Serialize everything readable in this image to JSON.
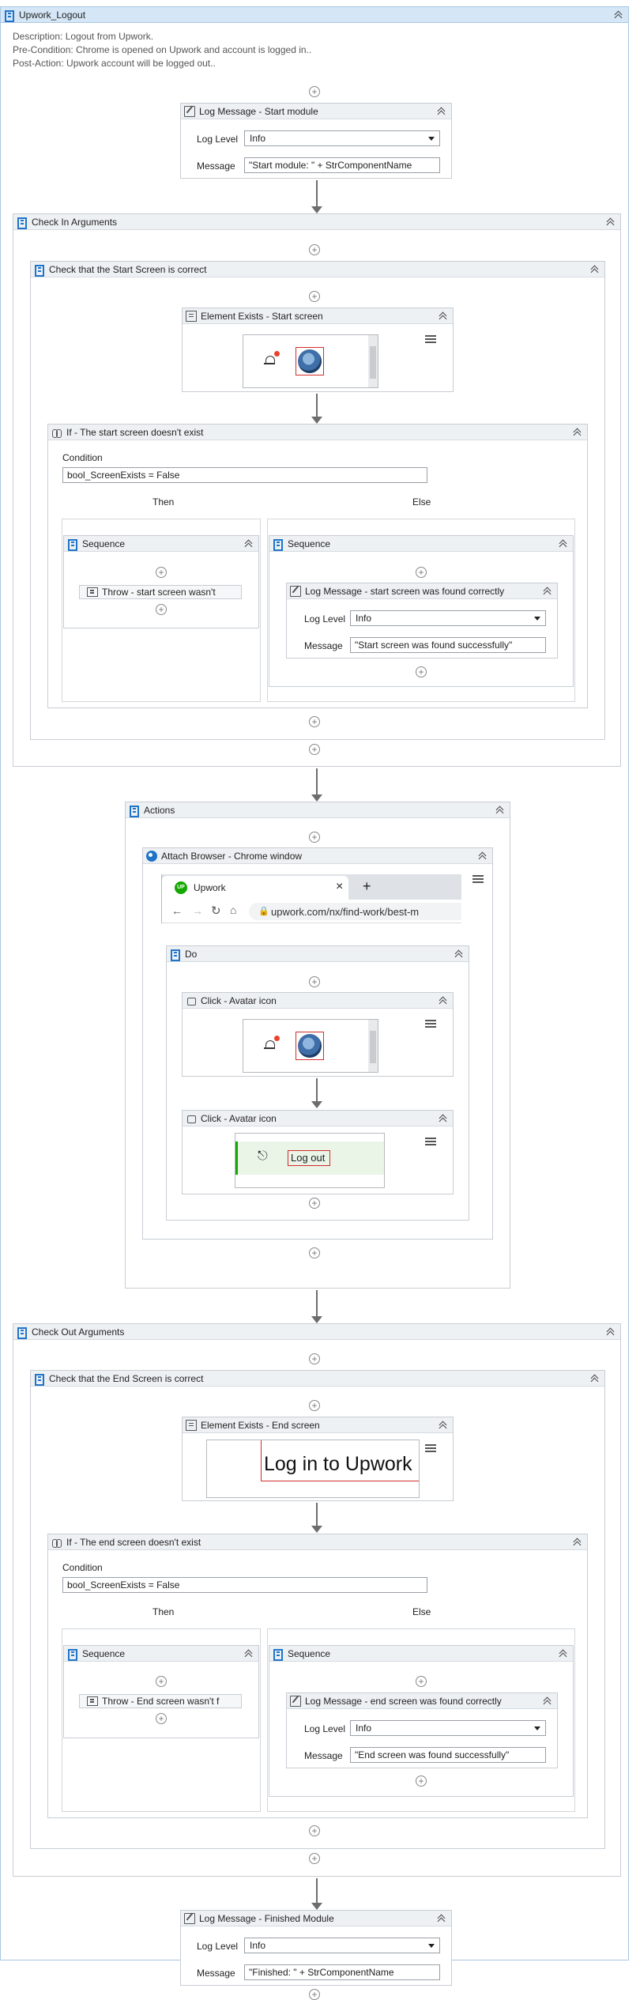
{
  "workflow": {
    "title": "Upwork_Logout",
    "description": "Description: Logout from Upwork.",
    "precondition": "Pre-Condition: Chrome is opened on Upwork and account is logged in..",
    "postaction": "Post-Action: Upwork account will be logged out.."
  },
  "log_start": {
    "title": "Log Message - Start module",
    "log_level_label": "Log Level",
    "log_level": "Info",
    "message_label": "Message",
    "message": "\"Start module: \" + StrComponentName"
  },
  "check_in": {
    "title": "Check In Arguments",
    "start_screen_check": {
      "title": "Check that the Start Screen is correct",
      "element_exists_title": "Element Exists - Start screen",
      "if": {
        "title": "If - The start screen doesn't exist",
        "condition_label": "Condition",
        "condition": "bool_ScreenExists = False",
        "then_label": "Then",
        "else_label": "Else",
        "then_sequence": "Sequence",
        "throw": "Throw - start screen wasn't",
        "else_sequence": "Sequence",
        "log": {
          "title": "Log Message - start screen was found correctly",
          "log_level_label": "Log Level",
          "log_level": "Info",
          "message_label": "Message",
          "message": "\"Start screen was found successfully\""
        }
      }
    }
  },
  "actions": {
    "title": "Actions",
    "attach_title": "Attach Browser - Chrome window",
    "browser": {
      "tab_title": "Upwork",
      "tab_logo": "UP",
      "close_glyph": "×",
      "newtab_glyph": "+",
      "url": "upwork.com/nx/find-work/best-m"
    },
    "do_title": "Do",
    "click1_title": "Click - Avatar icon",
    "click2_title": "Click - Avatar icon",
    "logout_label": "Log out"
  },
  "check_out": {
    "title": "Check Out Arguments",
    "end_screen_check": {
      "title": "Check that the End Screen is correct",
      "element_exists_title": "Element Exists - End screen",
      "preview_text": "Log in to Upwork",
      "if": {
        "title": "If - The end screen doesn't exist",
        "condition_label": "Condition",
        "condition": "bool_ScreenExists = False",
        "then_label": "Then",
        "else_label": "Else",
        "then_sequence": "Sequence",
        "throw": "Throw - End screen wasn't f",
        "else_sequence": "Sequence",
        "log": {
          "title": "Log Message - end screen was found correctly",
          "log_level_label": "Log Level",
          "log_level": "Info",
          "message_label": "Message",
          "message": "\"End screen was found successfully\""
        }
      }
    }
  },
  "log_finish": {
    "title": "Log Message - Finished Module",
    "log_level_label": "Log Level",
    "log_level": "Info",
    "message_label": "Message",
    "message": "\"Finished: \" + StrComponentName"
  },
  "colors": {
    "accent": "#1f74c9",
    "header_bg": "#eef1f4",
    "title_bar": "#d5e7f7",
    "selector_red": "#d32c2c"
  }
}
